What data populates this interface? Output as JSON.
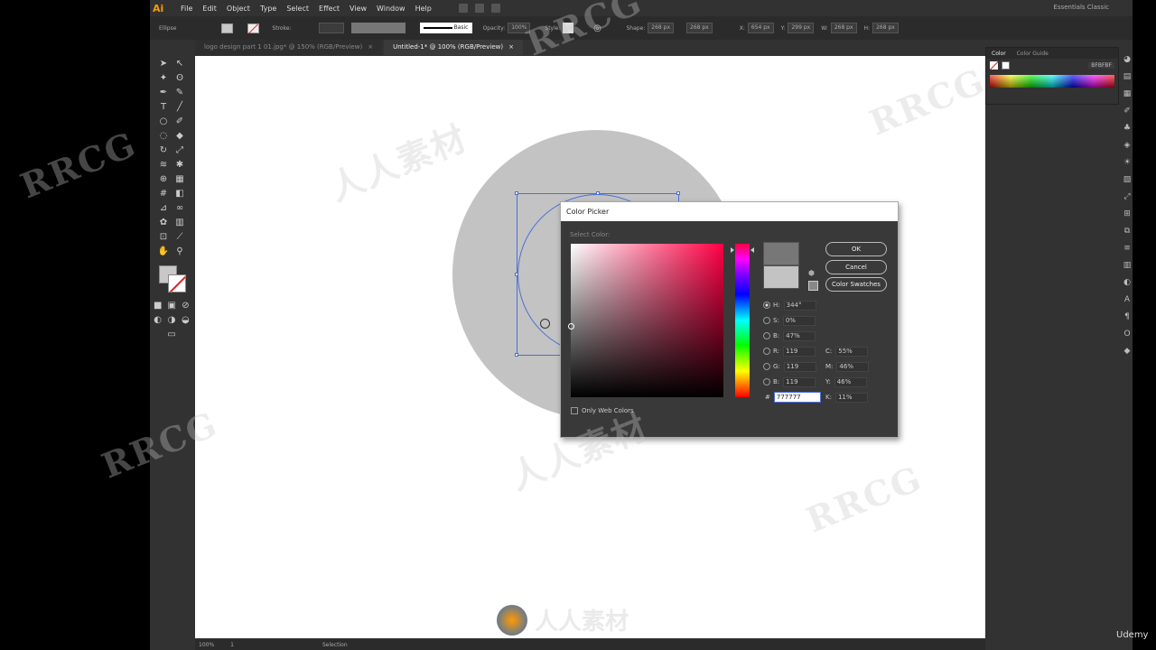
{
  "menubar": {
    "logo": "Ai",
    "items": [
      "File",
      "Edit",
      "Object",
      "Type",
      "Select",
      "Effect",
      "View",
      "Window",
      "Help"
    ],
    "workspace": "Essentials Classic"
  },
  "controlbar": {
    "selection_label": "Ellipse",
    "stroke_label": "Stroke:",
    "stroke_style": "Basic",
    "opacity_label": "Opacity:",
    "opacity_value": "100%",
    "style_label": "Style:",
    "shape_label": "Shape:",
    "shape_w": "268 px",
    "shape_h": "268 px",
    "x_label": "X:",
    "x_value": "654 px",
    "y_label": "Y:",
    "y_value": "299 px",
    "w_label": "W:",
    "w_value": "268 px",
    "h_label": "H:",
    "h_value": "268 px"
  },
  "tabs": [
    {
      "label": "logo design part 1 01.jpg* @ 150% (RGB/Preview)",
      "close": "×"
    },
    {
      "label": "Untitled-1* @ 100% (RGB/Preview)",
      "close": "×"
    }
  ],
  "color_panel": {
    "tab_color": "Color",
    "tab_guide": "Color Guide",
    "hex": "BFBFBF"
  },
  "statusbar": {
    "zoom": "100%",
    "artboard": "1",
    "tool": "Selection"
  },
  "dialog": {
    "title": "Color Picker",
    "select_label": "Select Color:",
    "ok": "OK",
    "cancel": "Cancel",
    "swatches": "Color Swatches",
    "only_web": "Only Web Colors",
    "new_color": "#777777",
    "old_color": "#c3c3c3",
    "h_label": "H:",
    "h_value": "344°",
    "s_label": "S:",
    "s_value": "0%",
    "b_label": "B:",
    "b_value": "47%",
    "r_label": "R:",
    "r_value": "119",
    "g_label": "G:",
    "g_value": "119",
    "bl_label": "B:",
    "bl_value": "119",
    "c_label": "C:",
    "c_value": "55%",
    "m_label": "M:",
    "m_value": "46%",
    "y_label": "Y:",
    "y_value": "46%",
    "k_label": "K:",
    "k_value": "11%",
    "hash": "#",
    "hex_value": "777777"
  },
  "watermark": {
    "text_a": "RRCG",
    "text_b": "人人素材",
    "logo_text": "人人素材",
    "udemy": "Udemy"
  },
  "colors": {
    "canvas_circle": "#c3c3c3",
    "selection": "#4a6fd8",
    "app_bg": "#323232",
    "ai_logo": "#ff9a00"
  }
}
